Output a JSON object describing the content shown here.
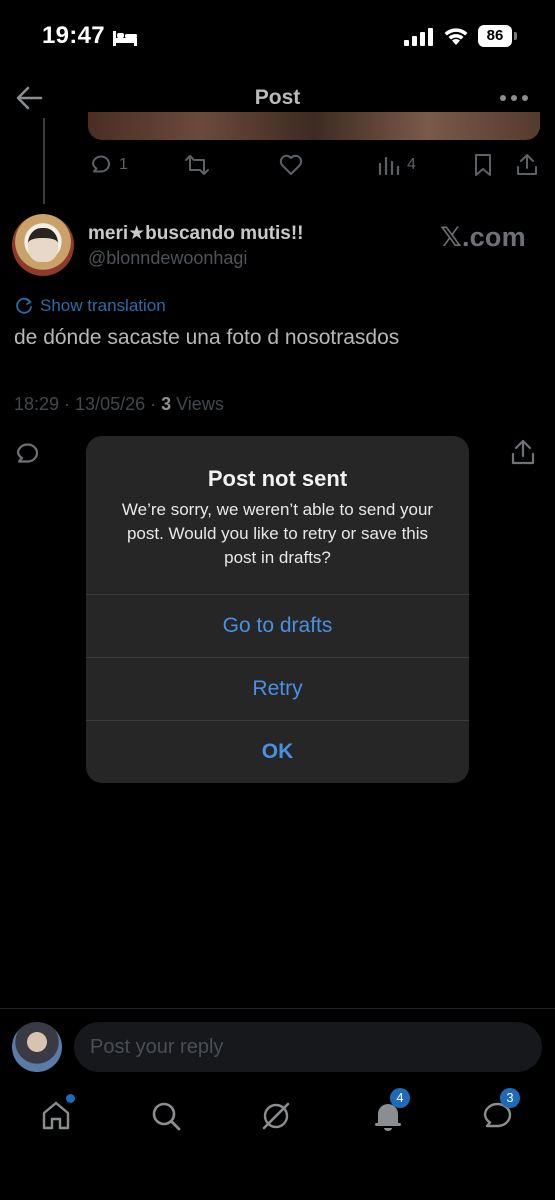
{
  "status_bar": {
    "time": "19:47",
    "battery": "86"
  },
  "nav": {
    "title": "Post",
    "back_icon": "arrow-left-icon",
    "more_icon": "ellipsis-icon"
  },
  "previous_post": {
    "actions": {
      "replies": "1",
      "reposts": "",
      "likes": "",
      "views": "4"
    }
  },
  "post": {
    "display_name": "meri★buscando mutis!!",
    "handle": "@blonndewoonhagi",
    "badge": "𝕏.com",
    "translate_label": "Show translation",
    "text": "de dónde sacaste una foto d nosotrasdos",
    "timestamp": "18:29 · 13/05/26 · ",
    "views_count": "3",
    "views_label": " Views"
  },
  "dialog": {
    "title": "Post not sent",
    "message": "We’re sorry, we weren’t able to send your post. Would you like to retry or save this post in drafts?",
    "buttons": {
      "drafts": "Go to drafts",
      "retry": "Retry",
      "ok": "OK"
    }
  },
  "reply_bar": {
    "placeholder": "Post your reply"
  },
  "tab_bar": {
    "items": [
      {
        "name": "home",
        "icon": "home-icon"
      },
      {
        "name": "search",
        "icon": "search-icon"
      },
      {
        "name": "grok",
        "icon": "grok-icon"
      },
      {
        "name": "notifications",
        "icon": "bell-icon",
        "badge": "4"
      },
      {
        "name": "messages",
        "icon": "message-icon",
        "badge": "3"
      }
    ]
  },
  "colors": {
    "accent": "#4a90e2",
    "badge": "#1d6bb8",
    "background": "#000000",
    "dialog": "#262626"
  }
}
